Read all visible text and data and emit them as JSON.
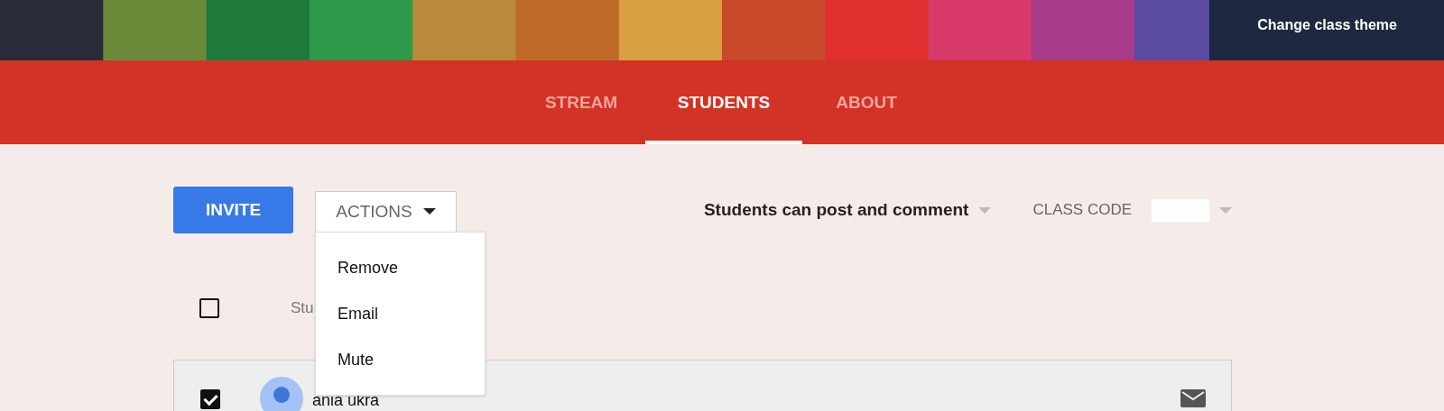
{
  "header": {
    "theme_link": "Change class theme"
  },
  "tabs": [
    {
      "label": "STREAM",
      "selected": false
    },
    {
      "label": "STUDENTS",
      "selected": true
    },
    {
      "label": "ABOUT",
      "selected": false
    }
  ],
  "toolbar": {
    "invite": "INVITE",
    "actions": "ACTIONS",
    "permission": "Students can post and comment",
    "class_code_label": "CLASS CODE"
  },
  "actions_menu": {
    "expanded": true,
    "items": [
      "Remove",
      "Email",
      "Mute"
    ]
  },
  "list_header": {
    "checked": false,
    "label": "Stu"
  },
  "students": [
    {
      "name": "ania ukra",
      "checked": true
    }
  ]
}
